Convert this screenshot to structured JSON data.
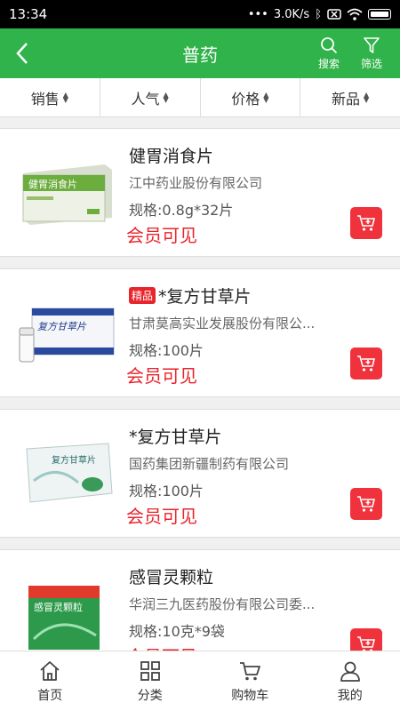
{
  "status": {
    "time": "13:34",
    "speed": "3.0K/s"
  },
  "header": {
    "title": "普药",
    "search_label": "搜索",
    "filter_label": "筛选"
  },
  "sort": {
    "items": [
      {
        "label": "销售"
      },
      {
        "label": "人气"
      },
      {
        "label": "价格"
      },
      {
        "label": "新品"
      }
    ]
  },
  "products": [
    {
      "name": "健胃消食片",
      "tag": "",
      "maker": "江中药业股份有限公司",
      "spec": "规格:0.8g*32片",
      "price": "会员可见",
      "image_text": "健胃消食片"
    },
    {
      "name": "*复方甘草片",
      "tag": "精品",
      "maker": "甘肃莫高实业发展股份有限公...",
      "spec": "规格:100片",
      "price": "会员可见",
      "image_text": "复方甘草片"
    },
    {
      "name": "*复方甘草片",
      "tag": "",
      "maker": "国药集团新疆制药有限公司",
      "spec": "规格:100片",
      "price": "会员可见",
      "image_text": "复方甘草片"
    },
    {
      "name": "感冒灵颗粒",
      "tag": "",
      "maker": "华润三九医药股份有限公司委...",
      "spec": "规格:10克*9袋",
      "price": "会员可见",
      "image_text": "感冒灵颗粒"
    }
  ],
  "tabs": [
    {
      "label": "首页"
    },
    {
      "label": "分类"
    },
    {
      "label": "购物车"
    },
    {
      "label": "我的"
    }
  ],
  "colors": {
    "brand": "#2fb34a",
    "price": "#e8242c",
    "cart": "#f0323c"
  }
}
